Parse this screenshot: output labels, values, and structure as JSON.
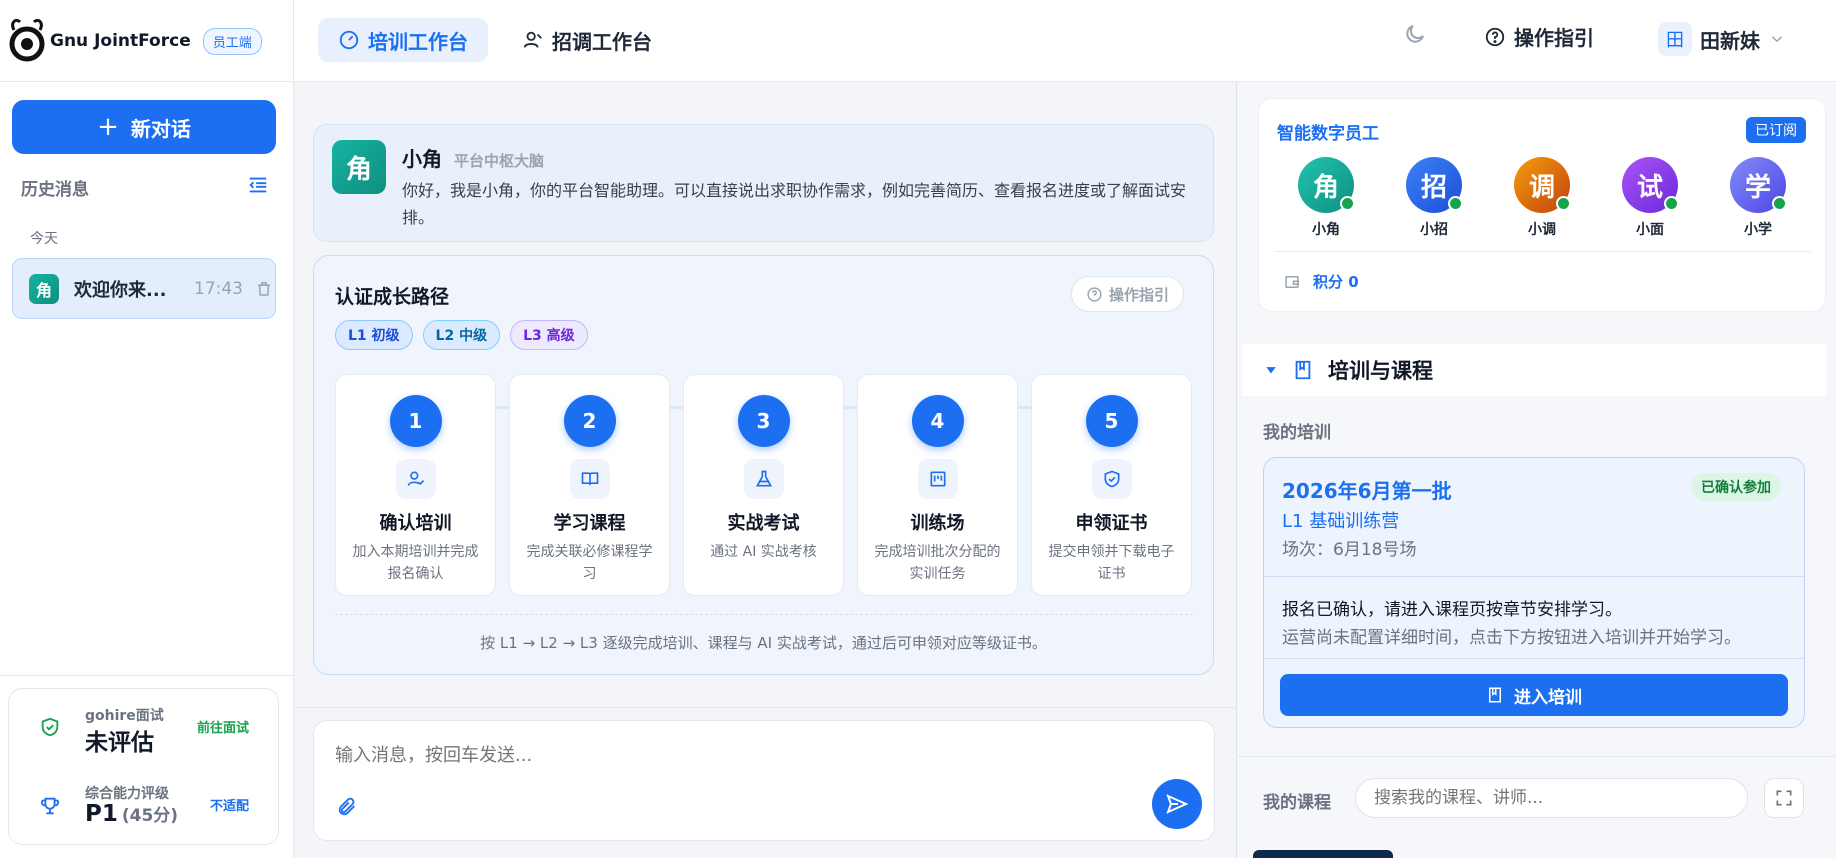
{
  "brand": {
    "name": "Gnu JointForce",
    "role_badge": "员工端"
  },
  "top_nav": {
    "tabs": [
      {
        "label": "培训工作台",
        "active": true
      },
      {
        "label": "招调工作台",
        "active": false
      }
    ],
    "guide_label": "操作指引",
    "user": {
      "avatar_char": "田",
      "name": "田新妹"
    }
  },
  "sidebar": {
    "new_chat_label": "新对话",
    "history_title": "历史消息",
    "today_label": "今天",
    "conversations": [
      {
        "avatar_char": "角",
        "title": "欢迎你来...",
        "time": "17:43"
      }
    ],
    "stats": {
      "interview": {
        "label": "gohire面试",
        "value": "未评估",
        "action": "前往面试"
      },
      "ability": {
        "label": "综合能力评级",
        "value": "P1",
        "score": "(45分)",
        "status": "不适配"
      }
    }
  },
  "assistant": {
    "avatar_char": "角",
    "name": "小角",
    "subtitle": "平台中枢大脑",
    "message": "你好，我是小角，你的平台智能助理。可以直接说出求职协作需求，例如完善简历、查看报名进度或了解面试安排。"
  },
  "path_card": {
    "title": "认证成长路径",
    "guide_label": "操作指引",
    "levels": [
      "L1 初级",
      "L2 中级",
      "L3 高级"
    ],
    "steps": [
      {
        "num": "1",
        "icon": "user-check-icon",
        "title": "确认培训",
        "desc": "加入本期培训并完成报名确认"
      },
      {
        "num": "2",
        "icon": "book-open-icon",
        "title": "学习课程",
        "desc": "完成关联必修课程学习"
      },
      {
        "num": "3",
        "icon": "flask-icon",
        "title": "实战考试",
        "desc": "通过 AI 实战考核"
      },
      {
        "num": "4",
        "icon": "kanban-icon",
        "title": "训练场",
        "desc": "完成培训批次分配的实训任务"
      },
      {
        "num": "5",
        "icon": "shield-check-icon",
        "title": "申领证书",
        "desc": "提交申领并下载电子证书"
      }
    ],
    "footer": "按 L1 → L2 → L3 逐级完成培训、课程与 AI 实战考试，通过后可申领对应等级证书。"
  },
  "composer": {
    "placeholder": "输入消息，按回车发送..."
  },
  "digital_staff": {
    "title": "智能数字员工",
    "badge": "已订阅",
    "employees": [
      {
        "char": "角",
        "name": "小角",
        "color": "#14a394"
      },
      {
        "char": "招",
        "name": "小招",
        "color": "#2563eb"
      },
      {
        "char": "调",
        "name": "小调",
        "color": "#d97706"
      },
      {
        "char": "试",
        "name": "小面",
        "color": "#7c3aed"
      },
      {
        "char": "学",
        "name": "小学",
        "color": "#6366f1"
      }
    ],
    "points_label": "积分 0"
  },
  "training": {
    "section_title": "培训与课程",
    "my_training_label": "我的培训",
    "item": {
      "batch": "2026年6月第一批",
      "status": "已确认参加",
      "camp": "L1 基础训练营",
      "session": "场次：6月18号场",
      "note_main": "报名已确认，请进入课程页按章节安排学习。",
      "note_sub": "运营尚未配置详细时间，点击下方按钮进入培训并开始学习。",
      "enter_label": "进入培训"
    },
    "my_courses_label": "我的课程",
    "course_search_placeholder": "搜索我的课程、讲师..."
  },
  "colors": {
    "primary": "#1d6ff2",
    "success": "#16a34a"
  }
}
